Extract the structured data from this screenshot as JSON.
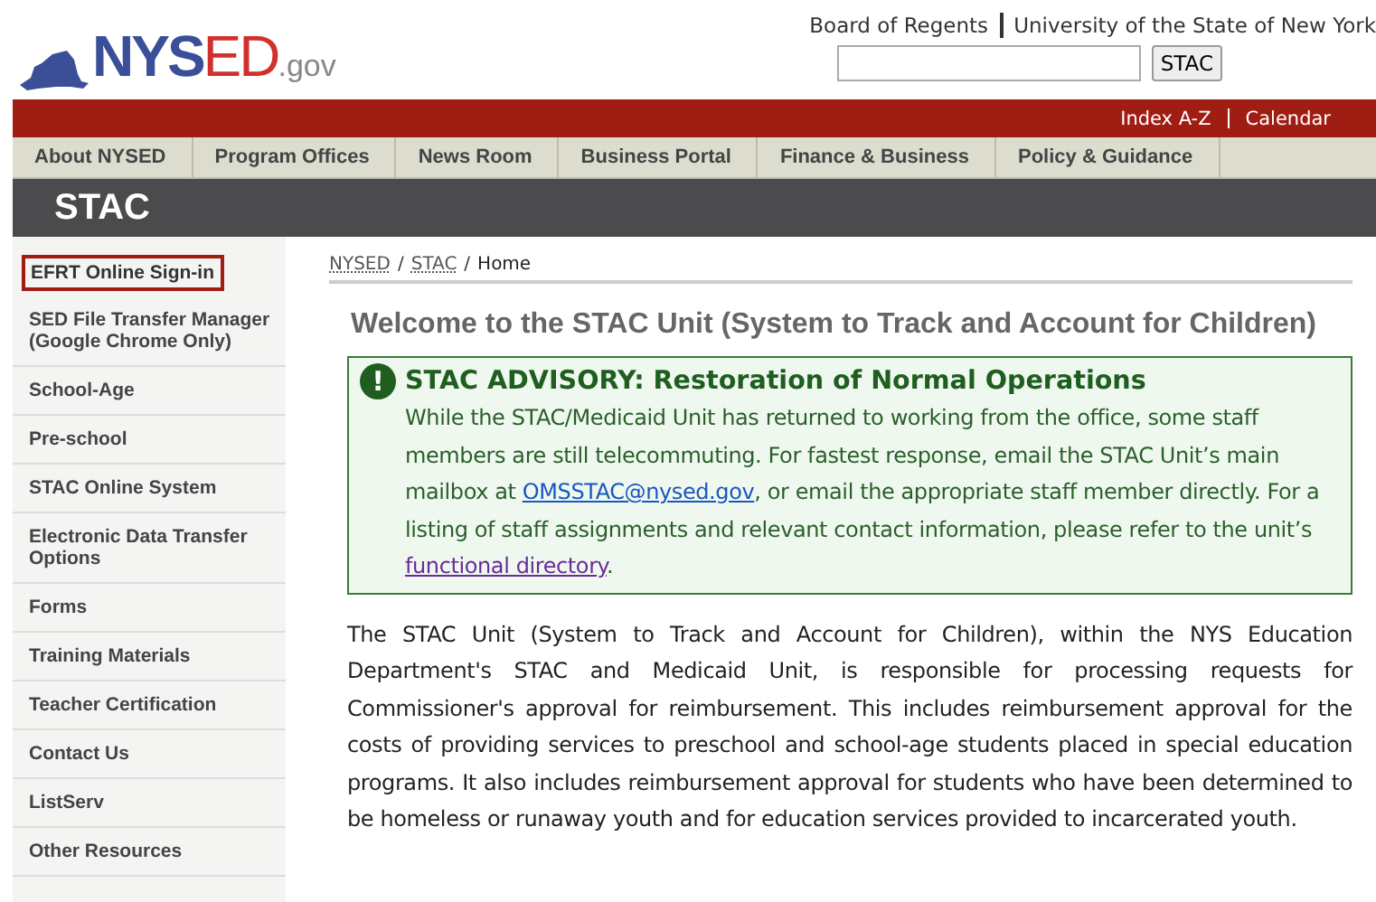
{
  "logo": {
    "parts": [
      {
        "text": "NYS",
        "kind": "blue"
      },
      {
        "text": "ED",
        "kind": "red"
      },
      {
        "text": ".gov",
        "kind": "grey"
      }
    ]
  },
  "top_links": [
    "Board of Regents",
    "University of the State of New York"
  ],
  "search": {
    "button": "STAC"
  },
  "utility_links": [
    "Index A-Z",
    "Calendar"
  ],
  "nav": [
    "About NYSED",
    "Program Offices",
    "News Room",
    "Business Portal",
    "Finance & Business",
    "Policy & Guidance"
  ],
  "section_title": "STAC",
  "sidebar": {
    "items": [
      {
        "label": "EFRT Online Sign-in",
        "selected": true
      },
      {
        "label": "SED File Transfer Manager (Google Chrome Only)",
        "selected": false
      },
      {
        "label": "School-Age",
        "selected": false
      },
      {
        "label": "Pre-school",
        "selected": false
      },
      {
        "label": "STAC Online System",
        "selected": false
      },
      {
        "label": "Electronic Data Transfer Options",
        "selected": false
      },
      {
        "label": "Forms",
        "selected": false
      },
      {
        "label": "Training Materials",
        "selected": false
      },
      {
        "label": "Teacher Certification",
        "selected": false
      },
      {
        "label": "Contact Us",
        "selected": false
      },
      {
        "label": "ListServ",
        "selected": false
      },
      {
        "label": "Other Resources",
        "selected": false
      }
    ]
  },
  "breadcrumb": [
    {
      "text": "NYSED",
      "kind": "link"
    },
    {
      "text": "/",
      "kind": "separator"
    },
    {
      "text": "STAC",
      "kind": "link"
    },
    {
      "text": "/",
      "kind": "separator"
    },
    {
      "text": "Home",
      "kind": "current"
    }
  ],
  "heading": "Welcome to the STAC Unit (System to Track and Account for Children)",
  "advisory": {
    "title": "STAC ADVISORY: Restoration of Normal Operations",
    "icon": "!",
    "body": [
      {
        "text": "While the STAC/Medicaid Unit has returned to working from the office, some staff members are still telecommuting. For fastest response, email the STAC Unit’s main mailbox at ",
        "kind": "text"
      },
      {
        "text": "OMSSTAC@nysed.gov",
        "kind": "link"
      },
      {
        "text": ", or email the appropriate staff member directly. For a listing of staff assignments and relevant contact information, please refer to the unit’s ",
        "kind": "text"
      },
      {
        "text": "functional directory",
        "kind": "visited"
      },
      {
        "text": ".",
        "kind": "text"
      }
    ]
  },
  "paragraph": "The STAC Unit (System to Track and Account for Children), within the NYS Education Department's STAC and Medicaid Unit, is responsible for processing requests for Commissioner's approval for reimbursement. This includes reimbursement approval for the costs of providing services to preschool and school-age students placed in special education programs. It also includes reimbursement approval for students who have been determined to be homeless or runaway youth and for education services provided to incarcerated youth."
}
